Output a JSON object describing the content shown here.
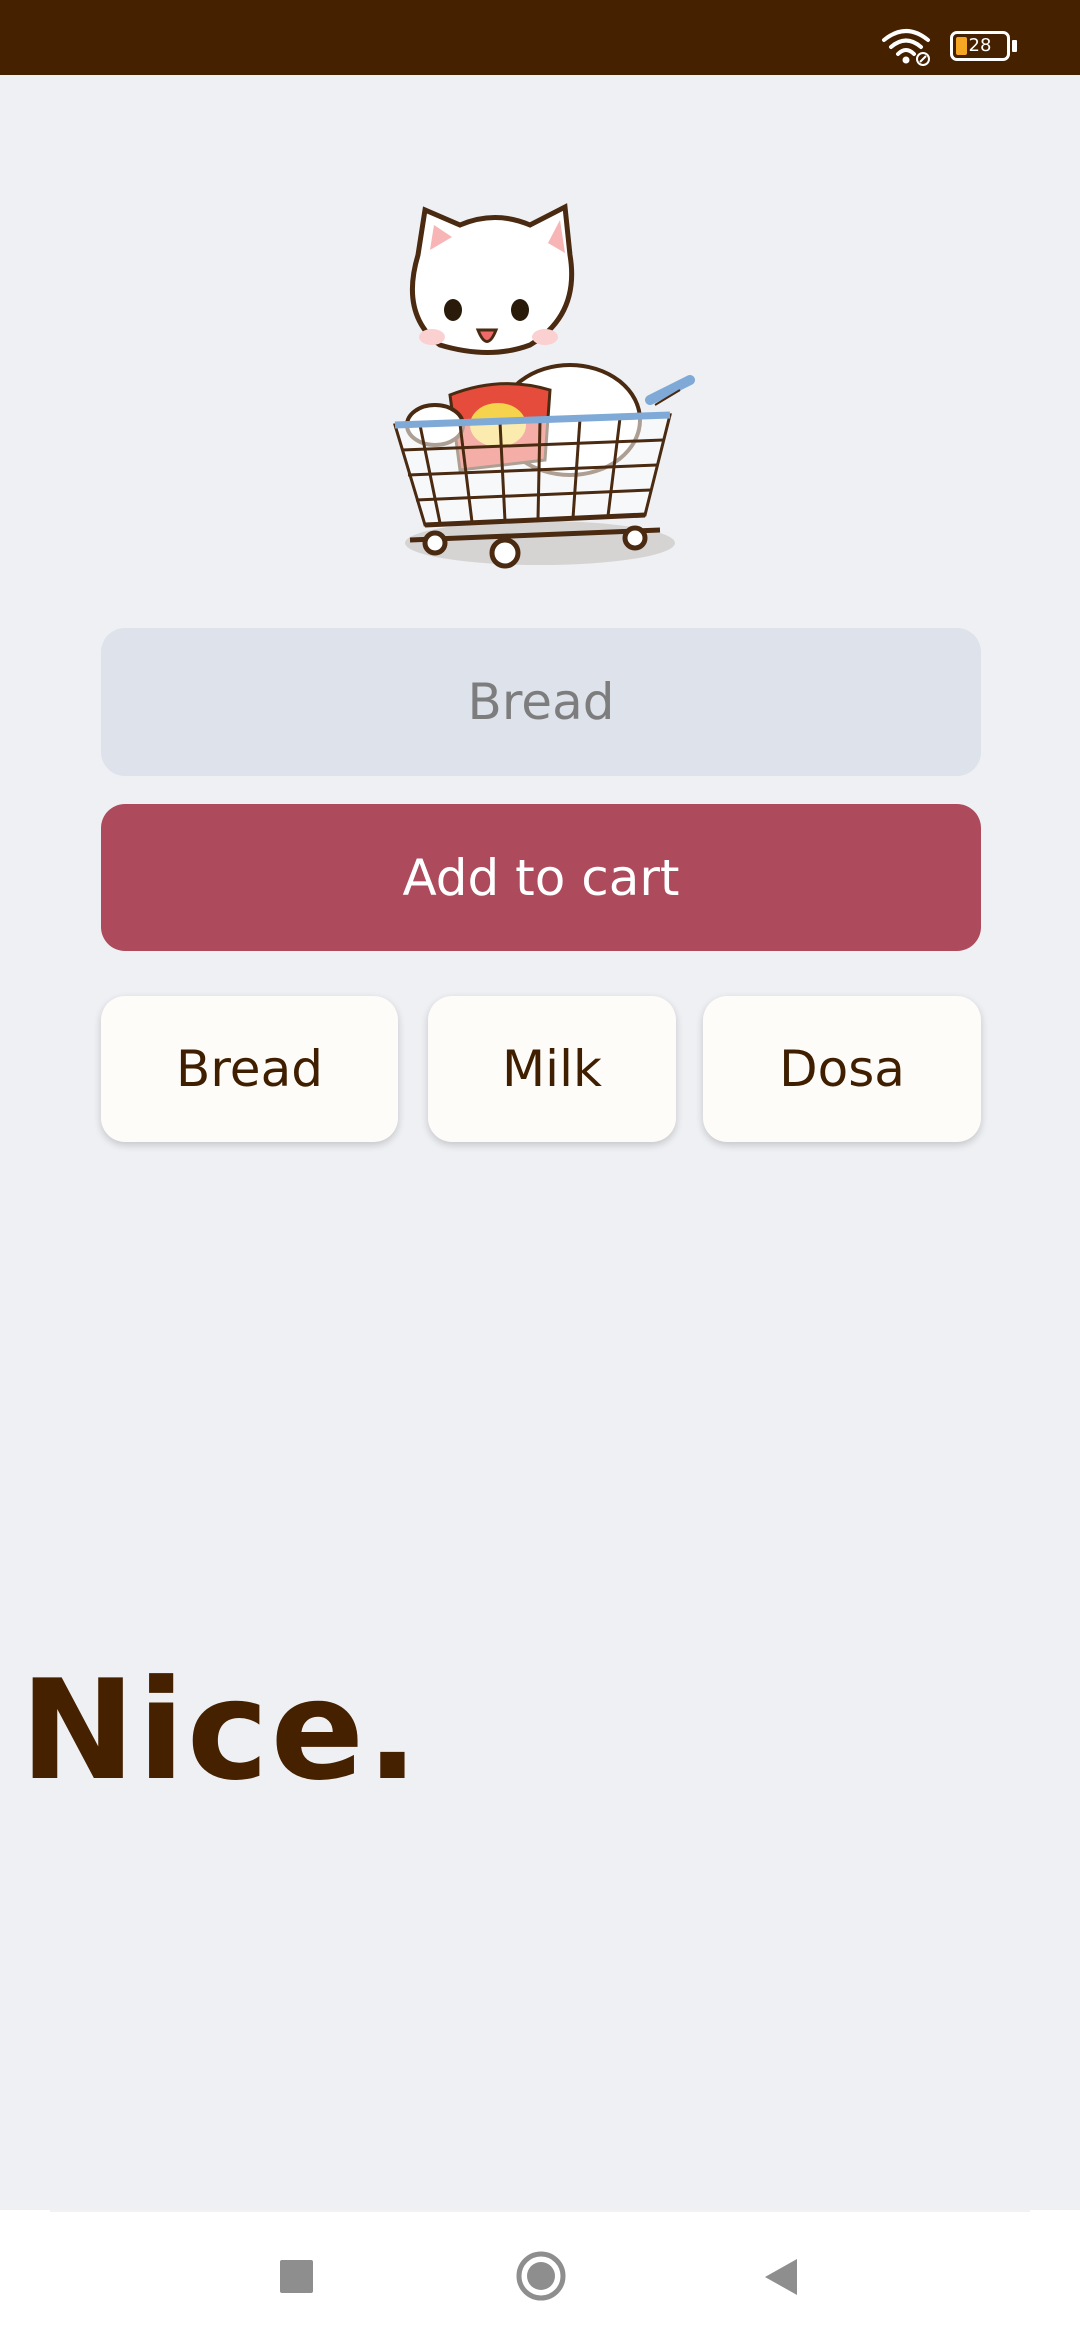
{
  "status_bar": {
    "battery_level": "28",
    "colors": {
      "background": "#452100",
      "battery_fill": "#f5a623"
    },
    "icons": [
      "wifi-icon",
      "battery-icon"
    ]
  },
  "mascot": {
    "icon": "cat-in-shopping-cart"
  },
  "form": {
    "input_value": "",
    "input_placeholder": "Bread",
    "add_button_label": "Add to cart",
    "colors": {
      "add_button": "#ad4a5b",
      "input_background": "#dde2eb"
    }
  },
  "suggestions": [
    {
      "label": "Bread"
    },
    {
      "label": "Milk"
    },
    {
      "label": "Dosa"
    }
  ],
  "result": {
    "message": "Nice."
  },
  "nav": {
    "icons": [
      "recents-icon",
      "home-icon",
      "back-icon"
    ]
  }
}
